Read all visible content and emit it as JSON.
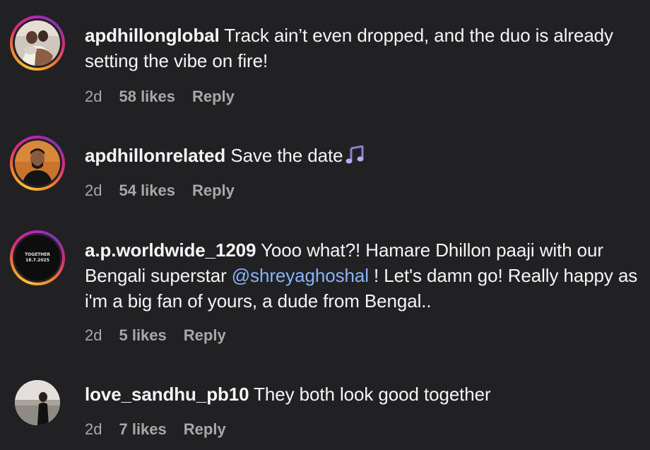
{
  "comments": [
    {
      "username": "apdhillonglobal",
      "text": "Track ain’t even dropped, and the duo is already setting the vibe on fire!",
      "time": "2d",
      "likes": "58 likes",
      "reply": "Reply"
    },
    {
      "username": "apdhillonrelated",
      "text": "Save the date",
      "icon": "musical-notes-icon",
      "time": "2d",
      "likes": "54 likes",
      "reply": "Reply"
    },
    {
      "username": "a.p.worldwide_1209",
      "text_before": "Yooo what?! Hamare Dhillon paaji with our Bengali superstar ",
      "mention": "@shreyaghoshal",
      "text_after": " ! Let's damn go! Really happy as i'm a big fan of yours, a dude from Bengal..",
      "avatar_text": [
        "TOGETHER",
        "18.7.2025"
      ],
      "time": "2d",
      "likes": "5 likes",
      "reply": "Reply"
    },
    {
      "username": "love_sandhu_pb10",
      "text": "They both look good together",
      "time": "2d",
      "likes": "7 likes",
      "reply": "Reply"
    }
  ],
  "colors": {
    "background": "#212124",
    "text": "#f5f5f5",
    "meta": "#a8a8a8",
    "mention": "#8ab4f8"
  }
}
